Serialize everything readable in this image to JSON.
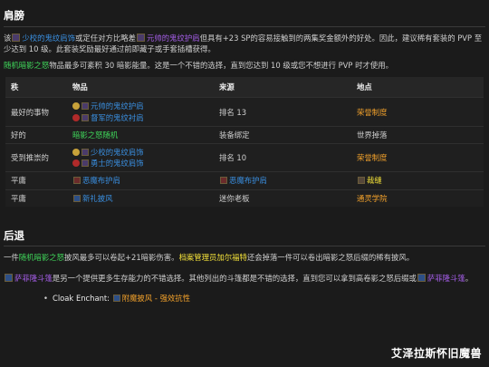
{
  "section1": {
    "title": "肩膀",
    "p1": {
      "prefix": "该",
      "item1": "少校的鬼纹肩饰",
      "mid1": "或定任对方比略差",
      "item2": "元帅的鬼纹护肩",
      "suffix": "但具有+23 SP的容易接触到的两集奖金额外的好处。因此，建议稀有套装的 PVP 至少达到 10 级。此套装奖励最好通过前即藏子或手套插槽获得。"
    },
    "p2": {
      "item": "随机暗影之怒",
      "text": "物品最多可紊积 30 暗影能量。这是一个不错的选择，直到您达到 10 级或您不想进行 PVP 时才使用。"
    }
  },
  "table": {
    "headers": [
      "秩",
      "物品",
      "来源",
      "地点"
    ],
    "rows": [
      {
        "rank": "最好的事物",
        "items": [
          {
            "emblem": "ally",
            "icon": "shoulder-icon",
            "name": "元帅的鬼纹护肩",
            "color": "blue"
          },
          {
            "emblem": "horde",
            "icon": "shoulder-icon",
            "name": "督军的鬼纹衬肩",
            "color": "blue"
          }
        ],
        "source": "排名 13",
        "location": "荣誉制度",
        "location_color": "orange"
      },
      {
        "rank": "好的",
        "items": [
          {
            "emblem": "",
            "icon": "",
            "name": "暗影之怒随机",
            "color": "green"
          }
        ],
        "source": "装备绑定",
        "location": "世界掉落",
        "location_color": "plain"
      },
      {
        "rank": "受到推崇的",
        "items": [
          {
            "emblem": "ally",
            "icon": "shoulder-icon",
            "name": "少校的鬼纹肩饰",
            "color": "blue"
          },
          {
            "emblem": "horde",
            "icon": "shoulder-icon",
            "name": "勇士的鬼纹肩饰",
            "color": "blue"
          }
        ],
        "source": "排名 10",
        "location": "荣誉制度",
        "location_color": "orange"
      },
      {
        "rank": "平庸",
        "items": [
          {
            "emblem": "",
            "icon": "shoulder-icon",
            "name": "恶魔布护肩",
            "color": "blue"
          }
        ],
        "source_icon": "shoulder-icon",
        "source": "恶魔布护肩",
        "source_color": "blue",
        "location_icon": "anvil-icon",
        "location": "裁缝",
        "location_color": "yellow"
      },
      {
        "rank": "平庸",
        "items": [
          {
            "emblem": "",
            "icon": "cloak-icon",
            "name": "新礼披风",
            "color": "blue"
          }
        ],
        "source": "迷你老板",
        "location": "通灵学院",
        "location_color": "orange"
      }
    ]
  },
  "section2": {
    "title": "后退",
    "p1": {
      "prefix": "一件",
      "item": "随机暗影之怒",
      "mid": "披风最多可以卷起+21暗影伤害。",
      "npc": "档案管理员加尔福特",
      "suffix": "还会掉落一件可以卷出暗影之怒后缀的稀有披风。"
    },
    "p2": {
      "item1": "萨菲隆斗篷",
      "text": "是另一个提供更多生存能力的不错选择。其他列出的斗篷都是不错的选择，直到您可以拿到高卷影之怒后缀或",
      "item2": "萨菲隆斗篷",
      "end": "。"
    },
    "enchant": {
      "label": "Cloak Enchant:",
      "link": "附魔披风 - 强效抗性"
    }
  },
  "watermark": "艾泽拉斯怀旧魔兽"
}
